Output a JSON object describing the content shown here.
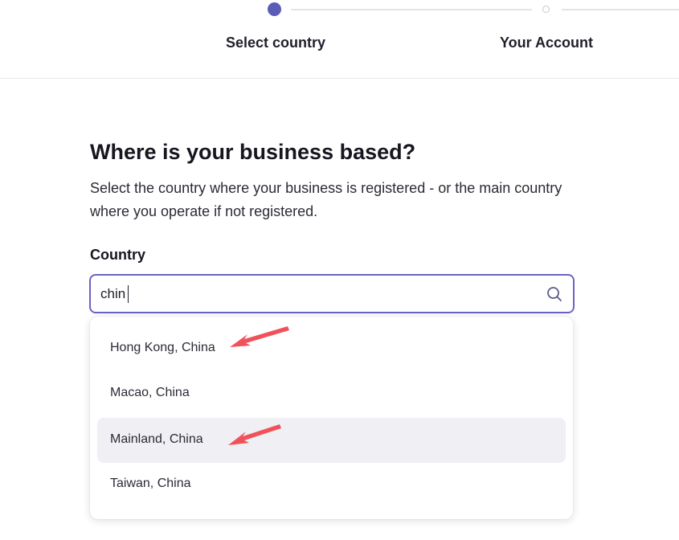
{
  "stepper": {
    "steps": [
      {
        "label": "Select country",
        "active": true
      },
      {
        "label": "Your Account",
        "active": false
      }
    ]
  },
  "main": {
    "heading": "Where is your business based?",
    "description": "Select the country where your business is registered - or the main country where you operate if not registered.",
    "country_label": "Country",
    "search": {
      "value": "chin",
      "icon": "search-icon"
    },
    "dropdown": {
      "options": [
        {
          "label": "Hong Kong, China",
          "highlighted": false
        },
        {
          "label": "Macao, China",
          "highlighted": false
        },
        {
          "label": "Mainland, China",
          "highlighted": true
        },
        {
          "label": "Taiwan, China",
          "highlighted": false
        }
      ]
    }
  },
  "colors": {
    "accent": "#5b5bb8",
    "input_border": "#6b63c4",
    "highlight": "#efeff4",
    "annotation_arrow": "#f0525a"
  }
}
